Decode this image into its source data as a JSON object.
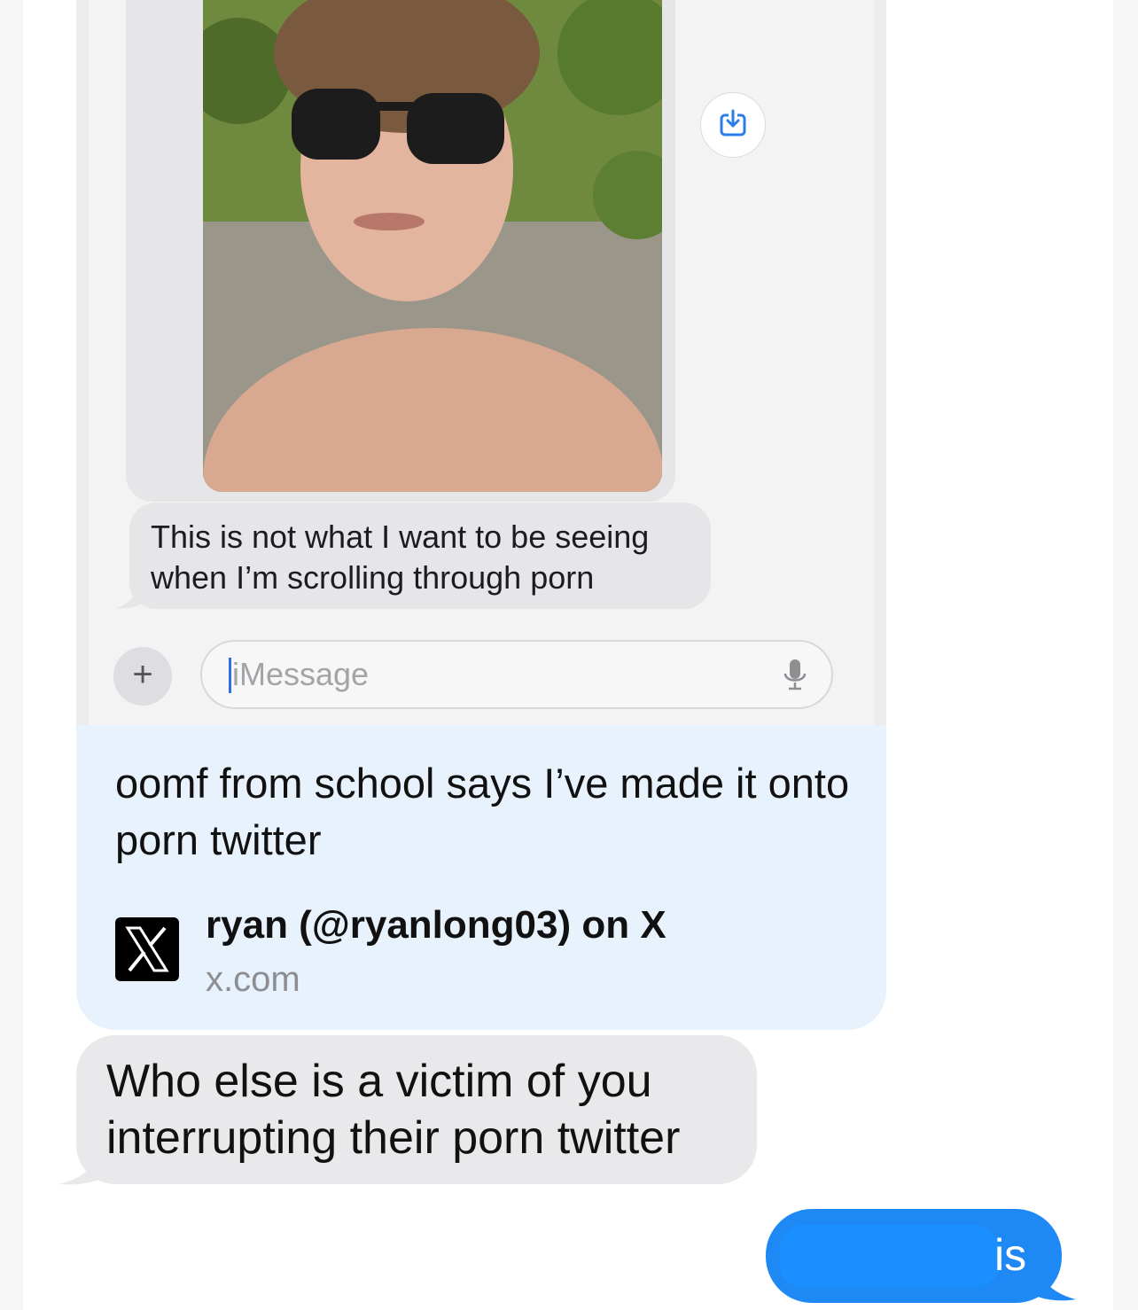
{
  "screenshot": {
    "photo_alt": "selfie of shirtless young man wearing sunglasses outdoors",
    "save_icon": "download-to-photos-icon",
    "message_text": "This is not what I want to be seeing when I’m scrolling through porn",
    "input": {
      "plus_label": "+",
      "placeholder": "iMessage",
      "mic_icon": "mic-icon"
    }
  },
  "link_message": {
    "text": "oomf from school says I’ve made it onto porn twitter",
    "preview": {
      "icon": "x-logo-icon",
      "title": "ryan (@ryanlong03) on X",
      "domain": "x.com"
    }
  },
  "received_message": {
    "text": "Who else is a victim of you interrupting their porn twitter"
  },
  "sent_message": {
    "text": "is",
    "redacted": true
  },
  "colors": {
    "sent_bubble": "#1e88f5",
    "received_bubble": "#e9e9eb",
    "link_bubble": "#e7f2fd"
  }
}
